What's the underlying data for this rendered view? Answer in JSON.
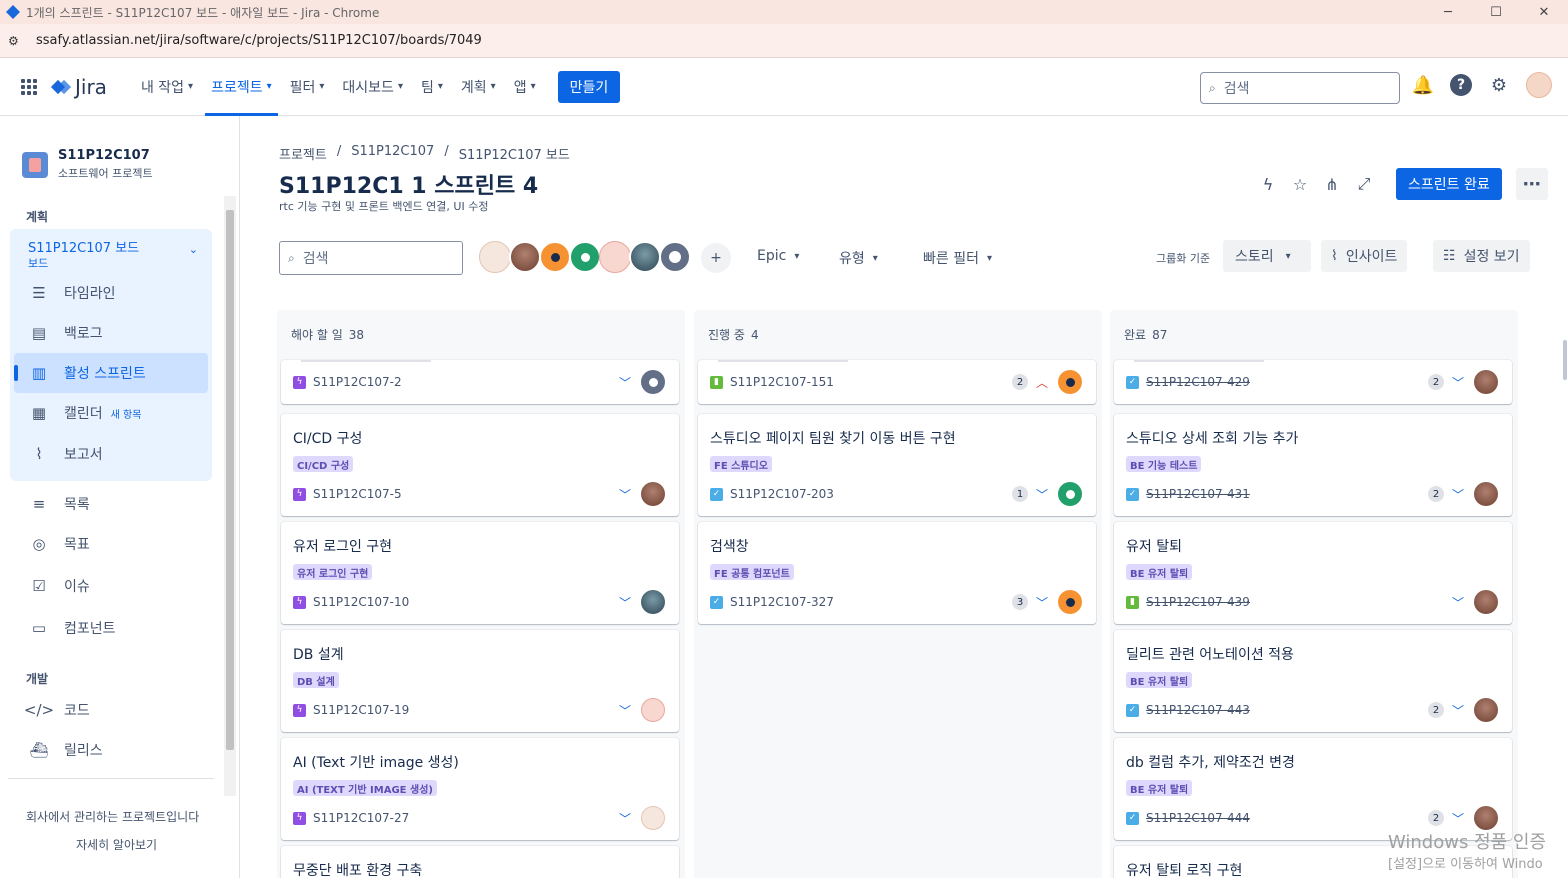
{
  "window": {
    "title": "1개의 스프린트 - S11P12C107 보드 - 애자일 보드 - Jira - Chrome",
    "minimize": "─",
    "maximize": "☐",
    "close": "✕"
  },
  "address": {
    "url": "ssafy.atlassian.net/jira/software/c/projects/S11P12C107/boards/7049"
  },
  "topnav": {
    "logo": "Jira",
    "items": [
      "내 작업",
      "프로젝트",
      "필터",
      "대시보드",
      "팀",
      "계획",
      "앱"
    ],
    "create": "만들기",
    "search_placeholder": "검색",
    "help": "?"
  },
  "sidebar": {
    "project_name": "S11P12C107",
    "project_type": "소프트웨어 프로젝트",
    "section_plan": "계획",
    "board_name": "S11P12C107 보드",
    "board_sub": "보드",
    "items": {
      "timeline": "타임라인",
      "backlog": "백로그",
      "active_sprint": "활성 스프린트",
      "calendar": "캘린더",
      "calendar_badge": "새 항목",
      "reports": "보고서",
      "list": "목록",
      "goals": "목표",
      "issues": "이슈",
      "components": "컴포넌트"
    },
    "section_dev": "개발",
    "dev_items": {
      "code": "코드",
      "releases": "릴리스"
    },
    "footer_text": "회사에서 관리하는 프로젝트입니다",
    "footer_link": "자세히 알아보기"
  },
  "main": {
    "breadcrumb": [
      "프로젝트",
      "/",
      "S11P12C107",
      "/",
      "S11P12C107 보드"
    ],
    "title": "S11P12C1 1 스프린트 4",
    "goal": "rtc 기능 구현 및 프론트 백엔드 연결, UI 수정",
    "complete_sprint": "스프린트 완료",
    "search_placeholder": "검색",
    "filters": {
      "epic": "Epic",
      "type": "유형",
      "quick": "빠른 필터"
    },
    "group_by_label": "그룹화 기준",
    "group_by_value": "스토리",
    "insights": "인사이트",
    "view_settings": "설정 보기"
  },
  "columns": [
    {
      "name": "해야 할 일",
      "count": "38",
      "cards": [
        {
          "title": "",
          "label": "",
          "type": "epic",
          "key": "S11P12C107-2",
          "est": "",
          "prio": "low",
          "avatar": "gray",
          "done": false
        },
        {
          "title": "CI/CD 구성",
          "label": "CI/CD 구성",
          "type": "epic",
          "key": "S11P12C107-5",
          "est": "",
          "prio": "low",
          "avatar": "brown",
          "done": false
        },
        {
          "title": "유저 로그인 구현",
          "label": "유저 로그인 구현",
          "type": "epic",
          "key": "S11P12C107-10",
          "est": "",
          "prio": "low",
          "avatar": "dark",
          "done": false
        },
        {
          "title": "DB 설계",
          "label": "DB 설계",
          "type": "epic",
          "key": "S11P12C107-19",
          "est": "",
          "prio": "low",
          "avatar": "pink",
          "done": false
        },
        {
          "title": "AI (Text 기반 image 생성)",
          "label": "AI (TEXT 기반 IMAGE 생성)",
          "type": "epic",
          "key": "S11P12C107-27",
          "est": "",
          "prio": "low",
          "avatar": "cream",
          "done": false
        },
        {
          "title": "무중단 배포 환경 구축",
          "label": "",
          "type": "epic",
          "key": "",
          "est": "",
          "prio": "",
          "avatar": "",
          "done": false
        }
      ]
    },
    {
      "name": "진행 중",
      "count": "4",
      "cards": [
        {
          "title": "",
          "label": "",
          "type": "story",
          "key": "S11P12C107-151",
          "est": "2",
          "prio": "high",
          "avatar": "orange",
          "done": false
        },
        {
          "title": "스튜디오 페이지 팀원 찾기 이동 버튼 구현",
          "label": "FE 스튜디오",
          "type": "task",
          "key": "S11P12C107-203",
          "est": "1",
          "prio": "low",
          "avatar": "green",
          "done": false
        },
        {
          "title": "검색창",
          "label": "FE 공통 컴포넌트",
          "type": "task",
          "key": "S11P12C107-327",
          "est": "3",
          "prio": "low",
          "avatar": "orange",
          "done": false
        }
      ]
    },
    {
      "name": "완료",
      "count": "87",
      "cards": [
        {
          "title": "",
          "label": "",
          "type": "task",
          "key": "S11P12C107-429",
          "est": "2",
          "prio": "low",
          "avatar": "brown",
          "done": true
        },
        {
          "title": "스튜디오 상세 조회 기능 추가",
          "label": "BE 기능 테스트",
          "type": "task",
          "key": "S11P12C107-431",
          "est": "2",
          "prio": "low",
          "avatar": "brown",
          "done": true
        },
        {
          "title": "유저 탈퇴",
          "label": "BE 유저 탈퇴",
          "type": "story",
          "key": "S11P12C107-439",
          "est": "",
          "prio": "low",
          "avatar": "brown",
          "done": true
        },
        {
          "title": "딜리트 관련 어노테이션 적용",
          "label": "BE 유저 탈퇴",
          "type": "task",
          "key": "S11P12C107-443",
          "est": "2",
          "prio": "low",
          "avatar": "brown",
          "done": true
        },
        {
          "title": "db 컬럼 추가, 제약조건 변경",
          "label": "BE 유저 탈퇴",
          "type": "task",
          "key": "S11P12C107-444",
          "est": "2",
          "prio": "low",
          "avatar": "brown",
          "done": true
        },
        {
          "title": "유저 탈퇴 로직 구현",
          "label": "",
          "type": "task",
          "key": "",
          "est": "",
          "prio": "",
          "avatar": "",
          "done": false
        }
      ]
    }
  ],
  "watermark": {
    "line1": "Windows 정품 인증",
    "line2": "[설정]으로 이동하여 Windo"
  },
  "icons": {
    "search": "search-icon",
    "bell": "notification-icon",
    "help": "help-icon",
    "settings": "gear-icon",
    "lightning": "automation-icon",
    "star": "star-icon",
    "share": "share-icon",
    "expand": "fullscreen-icon"
  },
  "colors": {
    "brand": "#0c66e4",
    "label_bg": "#dfd8fd",
    "label_text": "#5e4db2",
    "epic": "#904ee2",
    "task": "#4bade8",
    "story": "#63ba3c"
  }
}
